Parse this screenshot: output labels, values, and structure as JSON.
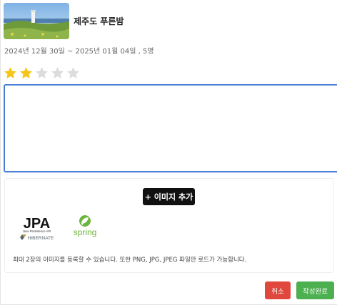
{
  "place": {
    "title": "제주도 푸른밤",
    "stay_info": "2024년 12월 30일 ~ 2025년 01월 04일 , 5명",
    "image_icon": "jeju-lighthouse-photo"
  },
  "rating": {
    "value": 2,
    "max": 5,
    "filled_color": "#f5c518",
    "empty_color": "#dcdcdc"
  },
  "review": {
    "value": "",
    "placeholder": ""
  },
  "upload": {
    "add_button_label": "+ 이미지 추가",
    "previews": [
      {
        "name": "jpa-hibernate-logo",
        "line1": "JPA",
        "line2": "Java Persistence API",
        "line3": "HIBERNATE"
      },
      {
        "name": "spring-logo",
        "text": "spring"
      }
    ],
    "hint": "최대 2장의 이미지를 등록할 수 있습니다. 또한 PNG, JPG, JPEG 파일만 로드가 가능합니다."
  },
  "actions": {
    "cancel_label": "취소",
    "submit_label": "작성완료"
  }
}
